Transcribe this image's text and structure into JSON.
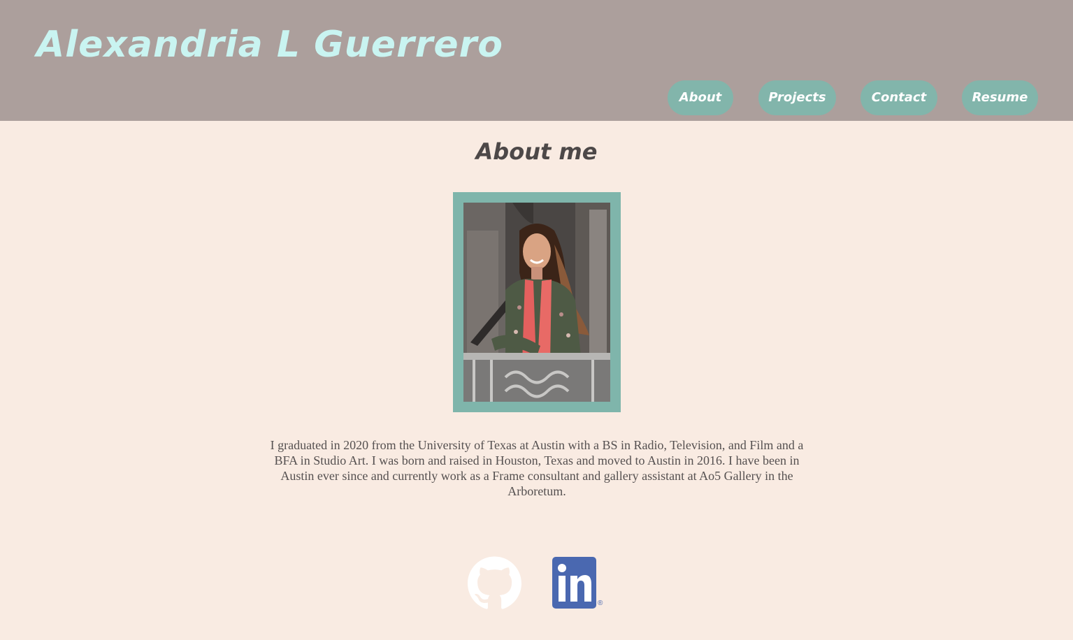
{
  "header": {
    "title": "Alexandria L Guerrero",
    "nav": [
      {
        "label": "About"
      },
      {
        "label": "Projects"
      },
      {
        "label": "Contact"
      },
      {
        "label": "Resume"
      }
    ]
  },
  "about": {
    "heading": "About me",
    "bio": "I graduated in 2020 from the University of Texas at Austin with a BS in Radio, Television, and Film and a BFA in Studio Art. I was born and raised in Houston, Texas and moved to Austin in 2016. I have been in Austin ever since and currently work as a Frame consultant and gallery assistant at Ao5 Gallery in the Arboretum."
  },
  "social": {
    "icons": [
      "github-icon",
      "linkedin-icon"
    ],
    "linkedin_mark": "®"
  },
  "colors": {
    "header_bg": "#ac9f9c",
    "page_bg": "#f9ebe2",
    "accent": "#7fb5ab",
    "title_text": "#c9f4f1",
    "linkedin_blue": "#4a68b0"
  }
}
